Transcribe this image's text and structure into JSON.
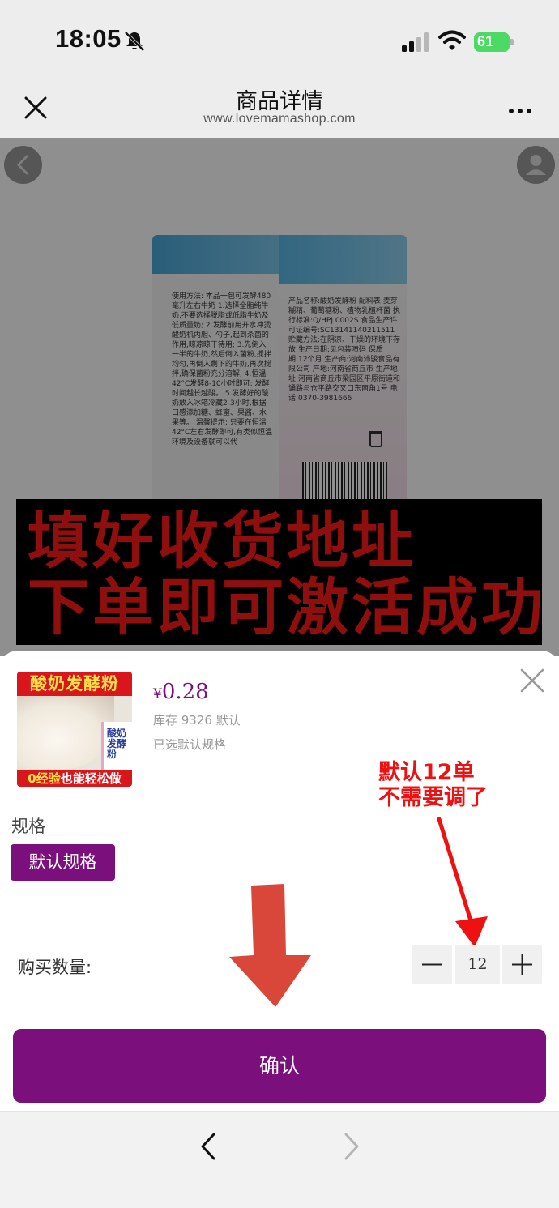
{
  "status_bar": {
    "time": "18:05",
    "battery_percent": "61",
    "icons": [
      "bell-slash-icon",
      "cellular-signal-icon",
      "wifi-icon",
      "battery-charging-icon"
    ]
  },
  "header": {
    "title": "商品详情",
    "url": "www.lovemamashop.com",
    "icons": [
      "close-icon",
      "more-icon"
    ]
  },
  "page_behind": {
    "promo_line_1": "填好收货地址",
    "promo_line_2": "下单即可激活成功",
    "package_text_left": "使用方法: 本品一包可发酵480毫升左右牛奶 1.选择全脂纯牛奶,不要选择脱脂或低脂牛奶及低质量奶; 2.发酵前用开水冲烫酸奶机内胆、勺子,起到杀菌的作用,晾凉晾干待用; 3.先倒入一半的牛奶,然后倒入菌粉,搅拌均匀,再倒入剩下的牛奶,再次搅拌,确保菌粉充分溶解; 4.恒温42°C发酵8-10小时即可; 发酵时间越长越酸。 5.发酵好的酸奶放入冰箱冷藏2-3小时,根据口感添加糖、蜂蜜、果酱、水果等。 温馨提示: 只要在恒温42°C左右发酵即可,有类似恒温环境及设备就可以代",
    "package_text_right": "产品名称:酸奶发酵粉 配料表:麦芽糊精、葡萄糖粉、植物乳植杆菌 执行标准:Q/HPJ 0002S 食品生产许可证编号:SC13141140211511 贮藏方法:在阴凉、干燥的环境下存放 生产日期:见包装喷码 保质期:12个月 生产商:河南沛骏食品有限公司 产地:河南省商丘市 生产地址:河南省商丘市梁园区平原街道和诵路与仓平路交叉口东南角1号 电话:0370-3981666"
  },
  "product": {
    "thumb_top_text": "酸奶发酵粉",
    "thumb_bag_text": "酸奶 发酵粉",
    "thumb_bottom_prefix": "0经验",
    "thumb_bottom_suffix": "也能轻松做",
    "currency": "¥",
    "price": "0.28",
    "stock_line": "库存 9326 默认",
    "selected_line": "已选默认规格"
  },
  "spec": {
    "label": "规格",
    "option": "默认规格"
  },
  "annotation": {
    "line_1": "默认12单",
    "line_2": "不需要调了",
    "color": "#ee1111"
  },
  "quantity": {
    "label": "购买数量:",
    "value": "12"
  },
  "confirm_label": "确认",
  "colors": {
    "accent": "#7b0f7b",
    "promo_text": "#ff1a1a",
    "arrow": "#d9473a"
  }
}
